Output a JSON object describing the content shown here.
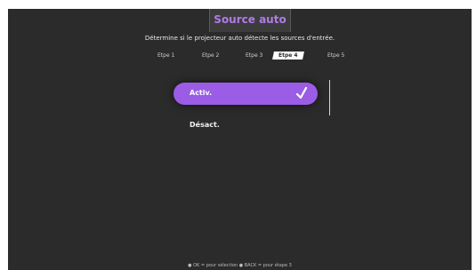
{
  "header": {
    "title": "Source auto",
    "description": "Détermine si le projecteur auto détecte les sources d'entrée."
  },
  "tabs": [
    {
      "label": "Etpe 1"
    },
    {
      "label": "Etpe 2"
    },
    {
      "label": "Etpe 3"
    },
    {
      "label": "Etpe 4"
    },
    {
      "label": "Etpe 5"
    }
  ],
  "options": {
    "selected_label": "Activ.",
    "other_label": "Désact."
  },
  "footer": {
    "hint": "● OK = pour sélection ● BACK = pour étape 3"
  },
  "colors": {
    "accent": "#9b5de5",
    "title": "#b07be8",
    "background": "#2b2b2b"
  }
}
